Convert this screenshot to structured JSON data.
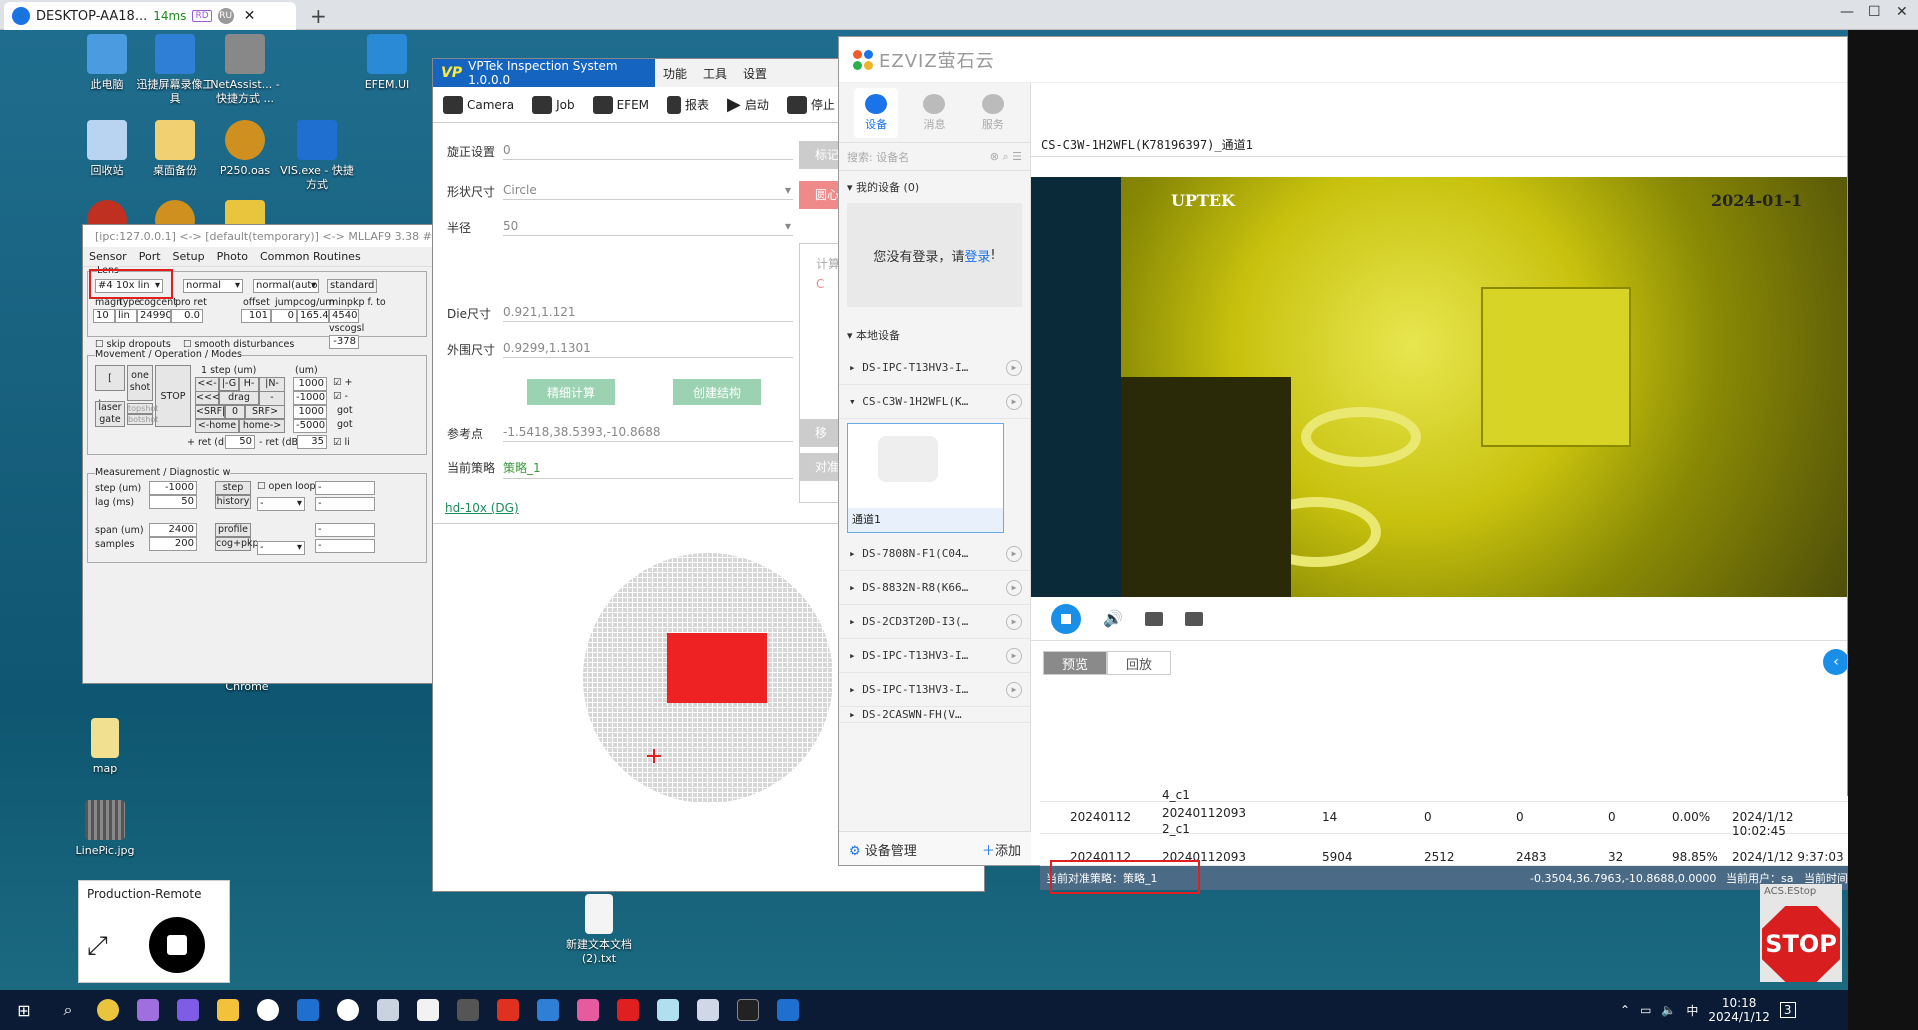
{
  "remote_tab": {
    "title": "DESKTOP-AA18...",
    "latency": "14ms",
    "chip_a": "RD",
    "chip_b": "RU",
    "avatar": "👤"
  },
  "desktop_icons": [
    {
      "label": "此电脑",
      "color": "#4a9be0"
    },
    {
      "label": "迅捷屏幕录像工具",
      "color": "#2f7fd6"
    },
    {
      "label": "NetAssist... - 快捷方式 ...",
      "color": "#888888"
    },
    {
      "label": "EFEM.UI",
      "color": "#2a8ad6"
    },
    {
      "label": "回收站",
      "color": "#b8d4f0"
    },
    {
      "label": "桌面备份",
      "color": "#f0d070"
    },
    {
      "label": "P250.oas",
      "color": "#d09020"
    },
    {
      "label": "VIS.exe - 快捷方式",
      "color": "#1f6fd0"
    },
    {
      "label": "map",
      "color": "#f0e090"
    },
    {
      "label": "LinePic.jpg",
      "color": "#666666"
    },
    {
      "label": "Chrome",
      "color": "#1a5f7a"
    },
    {
      "label": "新建文本文档 (2).txt",
      "color": "#f4f4f4"
    }
  ],
  "mllaf": {
    "title": "[ipc:127.0.0.1] <-> [default(temporary)] <-> MLLAF9 3.38 #",
    "menu": [
      "Sensor",
      "Port",
      "Setup",
      "Photo",
      "Common Routines"
    ],
    "lens_label": "Lens",
    "lens_value": "#4 10x lin",
    "mode_value": "normal",
    "auto_value": "normal(auto)",
    "std_value": "standard",
    "hdr": {
      "magn": "magn",
      "type": "type",
      "cogcent": "cogcent",
      "pro_ret": "pro ret",
      "offset": "offset",
      "jump": "jump",
      "cogum": "cog/um",
      "minpkp": "minpkp f. to"
    },
    "vals": {
      "magn": "10",
      "type": "lin",
      "cogcent": "249901",
      "pro_ret": "0.0",
      "offset": "101",
      "jump": "0",
      "cogum": "165.40",
      "minpkp": "4540"
    },
    "vscogsl": "vscogsl",
    "vscogsl_val": "-378",
    "skip": "skip dropouts",
    "smooth": "smooth disturbances",
    "movement_title": "Movement / Operation / Modes",
    "flaser": "[ laser",
    "one_shot": "one shot",
    "stop": "STOP",
    "laser_gate": "laser gate",
    "topshot": "topshot",
    "botshot": "botshot",
    "step_um": "1 step (um)",
    "um": "(um)",
    "b1": "<<-B",
    "b2": "|-G",
    "b3": "H->",
    "b4": "|N->>",
    "b5": "<<<-",
    "b6": "drag",
    "b7": "->>>",
    "b8": "<SRF|",
    "b9": "0",
    "b10": "SRF>",
    "b11": "<-home",
    "b12": "home->",
    "mv": [
      "1000",
      "-1000",
      "1000",
      "-5000"
    ],
    "got1": "got",
    "got2": "got",
    "plus_ret": "+ ret (dB)",
    "plus_ret_val": "50",
    "minus_ret": "- ret (dB)",
    "minus_ret_val": "35",
    "li": "li",
    "meas_title": "Measurement / Diagnostic w",
    "step_um2": "step (um)",
    "step_um2_val": "-1000",
    "lag": "lag (ms)",
    "lag_val": "50",
    "step_btn": "step",
    "history_btn": "history",
    "open_loop": "open loop",
    "span": "span (um)",
    "span_val": "2400",
    "samples": "samples",
    "samples_val": "200",
    "profile_btn": "profile",
    "cogpkp_btn": "cog+pkp",
    "dash": "-"
  },
  "vptek": {
    "title": "VPTek Inspection System 1.0.0.0",
    "vp": "VP",
    "menu": [
      "功能",
      "工具",
      "设置"
    ],
    "tools": [
      "Camera",
      "Job",
      "EFEM",
      "报表",
      "启动",
      "停止"
    ],
    "rows": [
      {
        "label": "旋正设置",
        "value": "0"
      },
      {
        "label": "形状尺寸",
        "value": "Circle"
      },
      {
        "label": "半径",
        "value": "50"
      },
      {
        "label": "Die尺寸",
        "value": "0.921,1.121"
      },
      {
        "label": "外围尺寸",
        "value": "0.9299,1.1301"
      },
      {
        "label": "参考点",
        "value": "-1.5418,38.5393,-10.8688"
      },
      {
        "label": "当前策略",
        "value": "策略_1"
      }
    ],
    "btn_fine": "精细计算",
    "btn_create": "创建结构",
    "side": [
      "标记",
      "圆心",
      "计算",
      "C",
      "移",
      "对准"
    ],
    "link": "hd-10x (DG)"
  },
  "ezviz": {
    "brand": "EZVIZ萤石云",
    "nav": [
      "设备",
      "消息",
      "服务"
    ],
    "search_placeholder": "搜索: 设备名",
    "my_devices": "我的设备 (0)",
    "login_msg": "您没有登录，请",
    "login_link": "登录",
    "login_end": "!",
    "local_devices": "本地设备",
    "devices_a": [
      "DS-IPC-T13HV3-I…",
      "CS-C3W-1H2WFL(K…"
    ],
    "camera_name": "通道1",
    "devices_b": [
      "DS-7808N-F1(C04…",
      "DS-8832N-R8(K66…",
      "DS-2CD3T20D-I3(…",
      "DS-IPC-T13HV3-I…",
      "DS-IPC-T13HV3-I…",
      "DS-2CASWN-FH(V…"
    ],
    "manage": "设备管理",
    "add": "添加",
    "channel": "CS-C3W-1H2WFL(K78196397)_通道1",
    "vid_brand": "UPTEK",
    "vid_date": "2024-01-1",
    "tabs": [
      "预览",
      "回放"
    ]
  },
  "table": {
    "r0": [
      "4_c1"
    ],
    "r1": [
      "20240112",
      "20240112093",
      "2_c1",
      "14",
      "0",
      "0",
      "0",
      "0.00%",
      "2024/1/12 10:02:45"
    ],
    "r2": [
      "20240112",
      "20240112093",
      "5904",
      "2512",
      "2483",
      "32",
      "98.85%",
      "2024/1/12 9:37:03"
    ]
  },
  "statusbar": {
    "strategy": "当前对准策略：策略_1",
    "coords": "-0.3504,36.7963,-10.8688,0.0000",
    "user": "当前用户：sa",
    "time": "当前时间"
  },
  "production": {
    "title": "Production-Remote"
  },
  "acs": {
    "title": "ACS.EStop",
    "stop": "STOP"
  },
  "taskbar": {
    "time": "10:18",
    "date": "2024/1/12",
    "ime": "中",
    "notif": "3",
    "apps": [
      "windows-start",
      "search",
      "chrome",
      "visual-studio",
      "vs-code",
      "file-explorer",
      "msg-app",
      "vis-app",
      "msc-app",
      "settings-app",
      "window-app",
      "film-app",
      "wps-app",
      "pc-app",
      "grid-app",
      "pdf-app",
      "notepad-app",
      "doc-app",
      "terminal-app",
      "efem-app"
    ],
    "app_colors": [
      "#ffffff",
      "#ffffff",
      "#e9c43d",
      "#9f6fe0",
      "#7d5ce6",
      "#f3c13a",
      "#ffffff",
      "#1f6fd0",
      "#ffffff",
      "#c9d3e0",
      "#f2f2f2",
      "#555555",
      "#e03020",
      "#2f7fd6",
      "#e65aa0",
      "#e02020",
      "#b0e0f0",
      "#d0d8e8",
      "#222222",
      "#1f6fd0"
    ]
  }
}
